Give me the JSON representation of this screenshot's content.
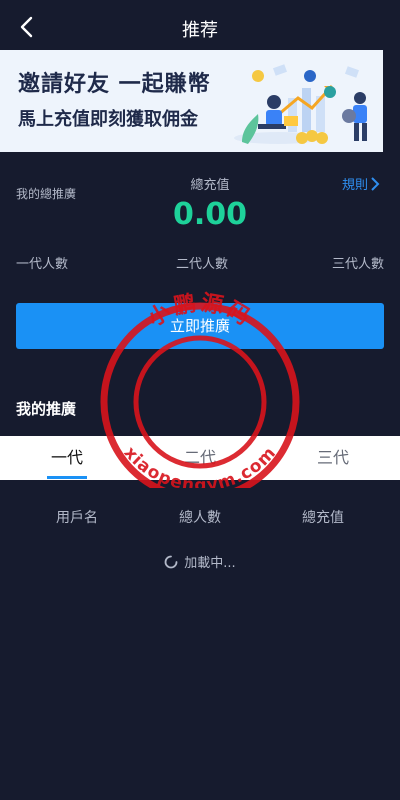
{
  "header": {
    "title": "推荐",
    "back_icon": "chevron-left-icon"
  },
  "banner": {
    "line1": "邀請好友 一起賺幣",
    "line2": "馬上充值即刻獲取佣金"
  },
  "stats": {
    "total_promo_label": "我的總推廣",
    "total_recharge_label": "總充值",
    "total_recharge_value": "0.00",
    "rules_label": "規則",
    "gen1_label": "一代人數",
    "gen2_label": "二代人數",
    "gen3_label": "三代人數"
  },
  "invite_button": {
    "label": "立即推廣"
  },
  "my_promo": {
    "title": "我的推廣"
  },
  "tabs": [
    {
      "label": "一代"
    },
    {
      "label": "二代"
    },
    {
      "label": "三代"
    }
  ],
  "table": {
    "columns": [
      "用戶名",
      "總人數",
      "總充值"
    ]
  },
  "loading": {
    "text": "加載中..."
  },
  "watermark": {
    "text1": "小鹏源码",
    "text2": "xiaopengym.com"
  },
  "colors": {
    "background": "#161b2e",
    "accent": "#1a91f5",
    "value_green": "#1ed29a",
    "stamp_red": "#d8141c"
  }
}
